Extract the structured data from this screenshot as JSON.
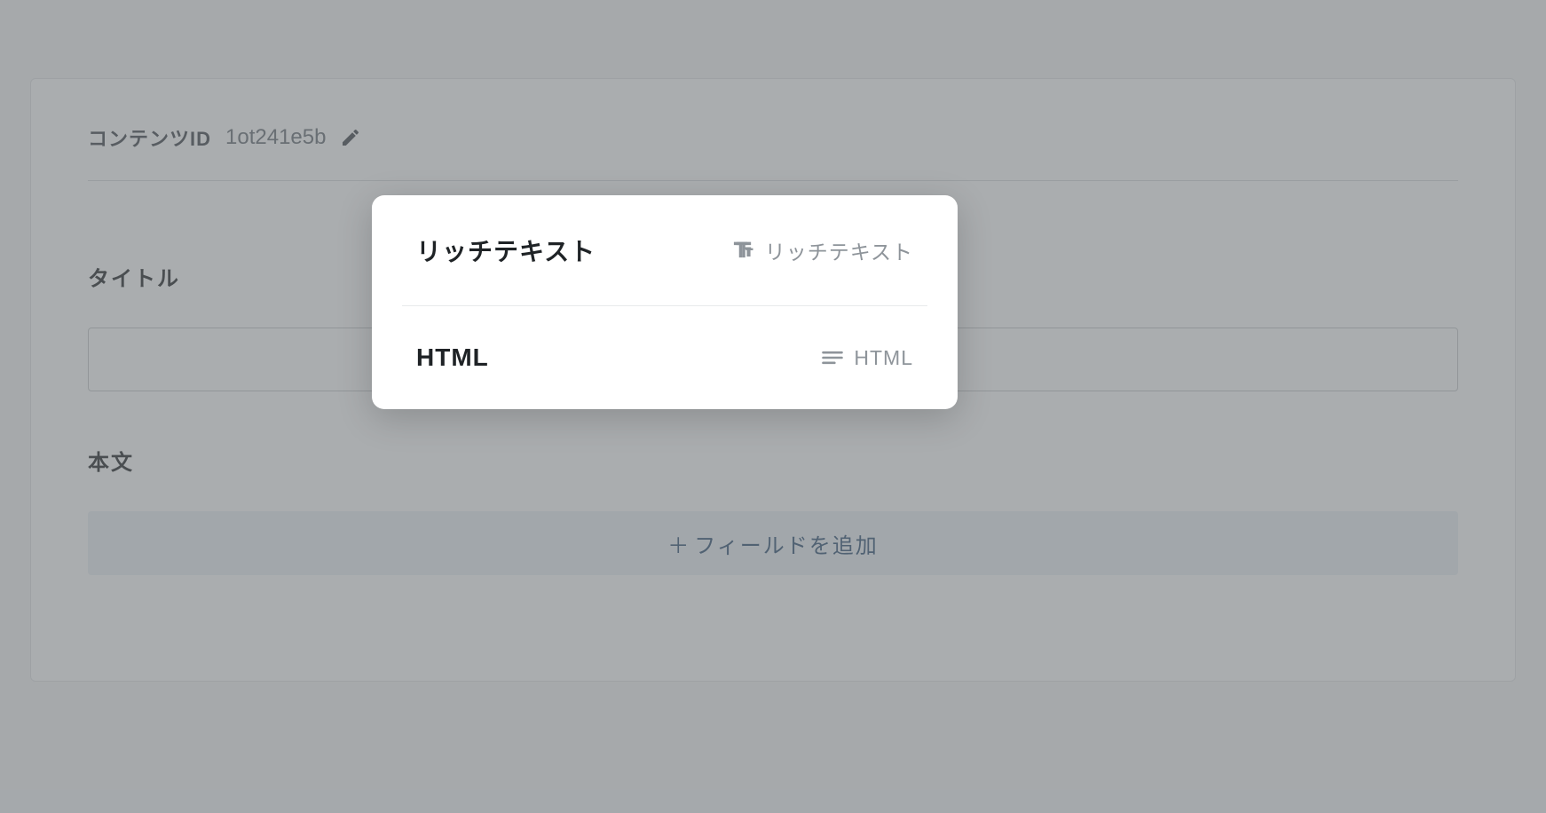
{
  "content": {
    "id_label": "コンテンツID",
    "id_value": "1ot241e5b"
  },
  "fields": {
    "title_label": "タイトル",
    "body_label": "本文",
    "add_field_label": "フィールドを追加"
  },
  "modal": {
    "options": [
      {
        "title": "リッチテキスト",
        "type_label": "リッチテキスト",
        "icon": "text"
      },
      {
        "title": "HTML",
        "type_label": "HTML",
        "icon": "lines"
      }
    ]
  }
}
